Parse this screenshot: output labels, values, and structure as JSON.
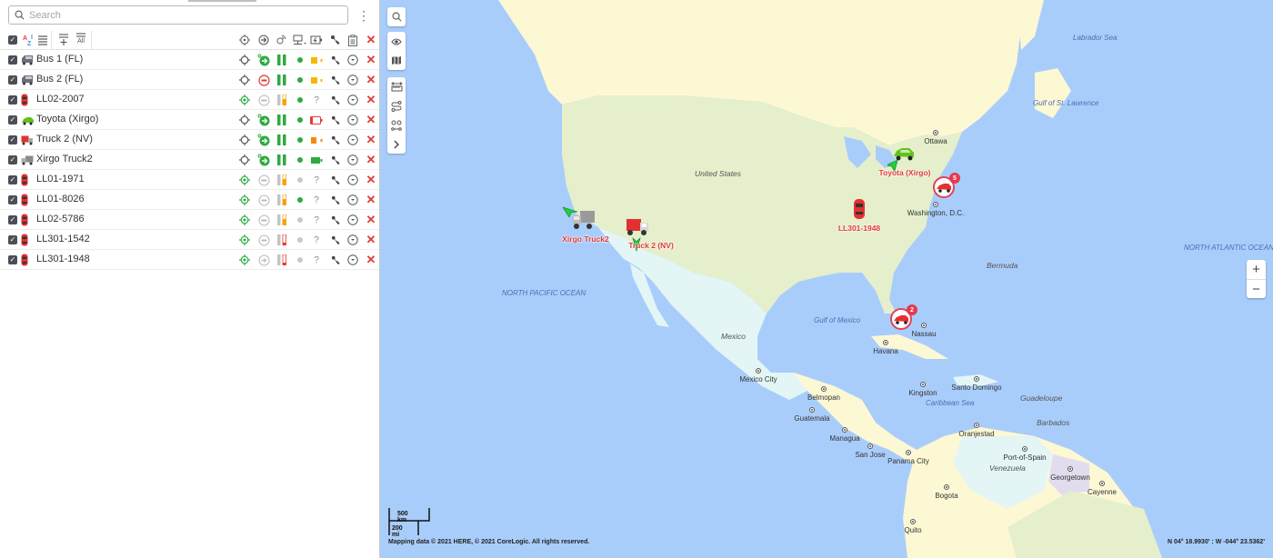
{
  "search": {
    "placeholder": "Search"
  },
  "toolbar": {
    "select_all_checked": true,
    "sort_icon": "sort-az-icon",
    "list_icon": "list-icon",
    "add_group_icon": "add-list-icon",
    "all_label": "All",
    "column_icons": [
      "locate-icon",
      "direction-icon",
      "satellite-icon",
      "network-icon",
      "battery-power-icon",
      "wrench-icon",
      "clipboard-icon",
      "delete-icon"
    ]
  },
  "units": [
    {
      "name": "Bus 1 (FL)",
      "type": "bus",
      "locate": "normal",
      "motion": "moving",
      "signal": "full",
      "status": "online",
      "battery": "yellow-high",
      "delete": "x"
    },
    {
      "name": "Bus 2 (FL)",
      "type": "bus",
      "locate": "normal",
      "motion": "stopped",
      "signal": "full",
      "status": "online",
      "battery": "yellow-high",
      "delete": "x"
    },
    {
      "name": "LL02-2007",
      "type": "car-red",
      "locate": "green",
      "motion": "idle",
      "signal": "partial-orange",
      "status": "online",
      "battery": "?",
      "delete": "x"
    },
    {
      "name": "Toyota (Xirgo)",
      "type": "car-green",
      "locate": "normal",
      "motion": "moving",
      "signal": "full",
      "status": "online",
      "battery": "red-low",
      "delete": "x"
    },
    {
      "name": "Truck 2 (NV)",
      "type": "truck-red",
      "locate": "normal",
      "motion": "moving",
      "signal": "full",
      "status": "online",
      "battery": "orange-mid",
      "delete": "x"
    },
    {
      "name": "Xirgo Truck2",
      "type": "truck-gray",
      "locate": "normal",
      "motion": "moving",
      "signal": "full",
      "status": "online",
      "battery": "green-full",
      "delete": "x"
    },
    {
      "name": "LL01-1971",
      "type": "car-red",
      "locate": "green",
      "motion": "idle",
      "signal": "partial-orange",
      "status": "offline",
      "battery": "?",
      "delete": "x"
    },
    {
      "name": "LL01-8026",
      "type": "car-red",
      "locate": "green",
      "motion": "idle",
      "signal": "partial-orange",
      "status": "online",
      "battery": "?",
      "delete": "x"
    },
    {
      "name": "LL02-5786",
      "type": "car-red",
      "locate": "green",
      "motion": "idle",
      "signal": "partial-orange",
      "status": "offline",
      "battery": "?",
      "delete": "x"
    },
    {
      "name": "LL301-1542",
      "type": "car-red",
      "locate": "green",
      "motion": "idle",
      "signal": "partial-red",
      "status": "offline",
      "battery": "?",
      "delete": "x"
    },
    {
      "name": "LL301-1948",
      "type": "car-red",
      "locate": "green",
      "motion": "arrow-gray",
      "signal": "partial-red",
      "status": "offline",
      "battery": "?",
      "delete": "x"
    }
  ],
  "map": {
    "controls": [
      "search-icon",
      "eye-icon",
      "map-layers-icon",
      "ruler-icon",
      "route-icon",
      "geofence-icon",
      "expand-icon"
    ],
    "zoom_in": "+",
    "zoom_out": "−",
    "seas": [
      "Labrador Sea",
      "Gulf of St. Lawrence",
      "NORTH ATLANTIC OCEAN",
      "NORTH PACIFIC OCEAN",
      "Gulf of Mexico",
      "Caribbean Sea",
      "Bermuda",
      "Guadeloupe",
      "Barbados"
    ],
    "countries": [
      "United States",
      "Mexico",
      "Venezuela"
    ],
    "cities": [
      "Ottawa",
      "Washington, D.C.",
      "Nassau",
      "Havana",
      "Mexico City",
      "Belmopan",
      "Guatemala",
      "Kingston",
      "Santo Domingo",
      "Managua",
      "San Jose",
      "Panama City",
      "Oranjestad",
      "Port-of-Spain",
      "Georgetown",
      "Cayenne",
      "Bogota",
      "Quito"
    ],
    "vehicle_labels": {
      "xirgo_truck2": "Xirgo Truck2",
      "truck2": "Truck 2 (NV)",
      "toyota": "Toyota (Xirgo)",
      "ll301": "LL301-1948"
    },
    "clusters": {
      "northeast": "5",
      "florida": "2"
    },
    "scale": {
      "km": "500 km",
      "mi": "200 mi"
    },
    "attribution": "Mapping data © 2021 HERE, © 2021 CoreLogic. All rights reserved.",
    "coordinates": "N 04° 18.9930' : W -044° 23.5362'"
  },
  "colors": {
    "accent_red": "#e53935",
    "online_green": "#2eaa3f",
    "ocean": "#a9cdfb"
  }
}
